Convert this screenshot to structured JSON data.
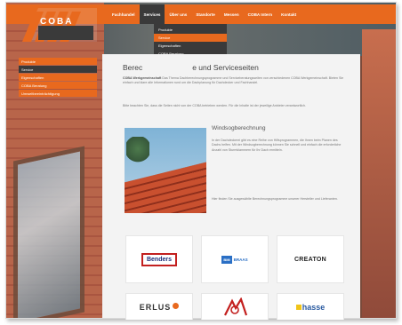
{
  "brand": {
    "logo_text": "COBA",
    "accent_color": "#e8691e",
    "dark_color": "#3a3a3a"
  },
  "nav": {
    "items": [
      {
        "label": "Fachhandel"
      },
      {
        "label": "Services",
        "active": true
      },
      {
        "label": "Über uns"
      },
      {
        "label": "Standorte"
      },
      {
        "label": "Messen"
      },
      {
        "label": "COBA Intern"
      },
      {
        "label": "Kontakt"
      }
    ]
  },
  "dropdown": {
    "items": [
      {
        "label": "Produkte"
      },
      {
        "label": "Service",
        "active": true
      },
      {
        "label": "Eigenschaften"
      },
      {
        "label": "COBA Beratung"
      },
      {
        "label": "Umweltbeeinträchtigung"
      }
    ]
  },
  "sidebar": {
    "items": [
      {
        "label": "Produkte",
        "style": "orange"
      },
      {
        "label": "Service",
        "style": "dark"
      },
      {
        "label": "Eigenschaften",
        "style": "orange"
      },
      {
        "label": "COBA Beratung",
        "style": "orange"
      },
      {
        "label": "Umweltbeeinträchtigung",
        "style": "orange"
      }
    ]
  },
  "content": {
    "title_left": "Berec",
    "title_right": "e und Serviceseiten",
    "intro_bold": "COBA Werkgemeinschaft",
    "intro": "Das Thema Dachberechnungsprogramme und Serviceberatungsseiten von verschiedenen COBA Werkgemeinschaft. Bieten Sie einfach und klare alle Informationen rund um die Dachplanung für Dachdecker und Fachhandel.",
    "para2": "Bitte beachten Sie, dass die Seiten nicht von der COBA betrieben werden. Für die Inhalte ist der jeweilige Anbieter verantwortlich.",
    "section_title": "Windsogberechnung",
    "section_text": "In der Dachdeckerei gibt es eine Reihe von Hilfsprogrammen, die Ihnen beim Planen des Dachs helfen. Mit der Windsogberechnung können Sie schnell und einfach die erforderliche Anzahl von Sturmklammern für Ihr Dach ermitteln.",
    "section_text2": "Hier finden Sie ausgewählte Berechnungsprogramme unserer Hersteller und Lieferanten."
  },
  "brands": [
    {
      "name": "Benders"
    },
    {
      "name": "BMI",
      "sub": "BRAAS"
    },
    {
      "name": "CREATON"
    },
    {
      "name": "ERLUS"
    },
    {
      "name": ""
    },
    {
      "name": "hasse"
    }
  ]
}
